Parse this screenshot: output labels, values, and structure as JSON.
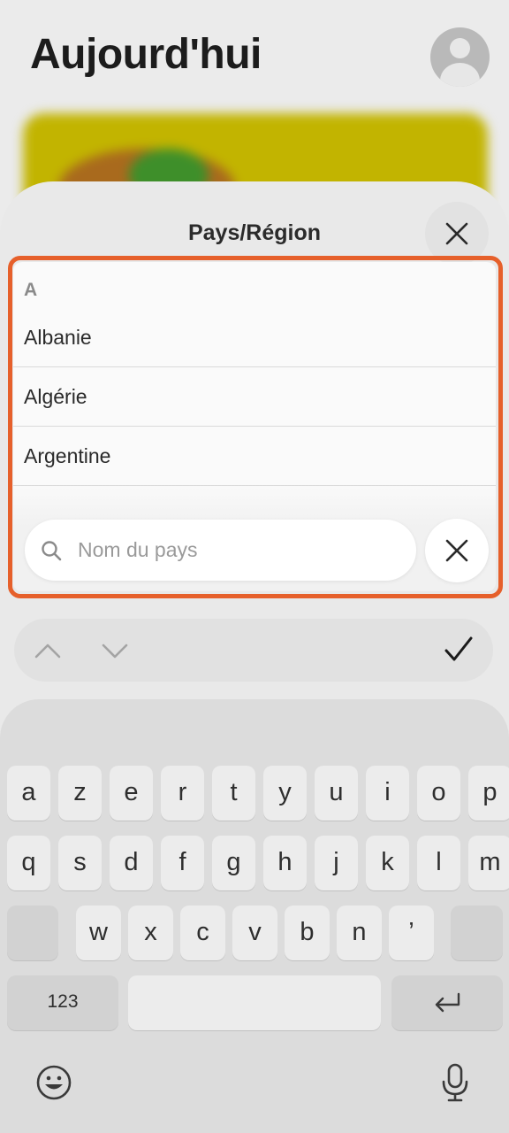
{
  "background": {
    "title": "Aujourd'hui"
  },
  "sheet": {
    "title": "Pays/Région",
    "section_letter": "A",
    "countries": [
      {
        "label": "Albanie"
      },
      {
        "label": "Algérie"
      },
      {
        "label": "Argentine"
      }
    ],
    "search": {
      "placeholder": "Nom du pays",
      "icon": "search-icon",
      "clear_icon": "close-icon"
    },
    "close_icon": "close-icon"
  },
  "keyboard": {
    "row1": [
      "a",
      "z",
      "e",
      "r",
      "t",
      "y",
      "u",
      "i",
      "o",
      "p"
    ],
    "row2": [
      "q",
      "s",
      "d",
      "f",
      "g",
      "h",
      "j",
      "k",
      "l",
      "m"
    ],
    "row3": [
      "w",
      "x",
      "c",
      "v",
      "b",
      "n",
      "’"
    ],
    "numbers_label": "123"
  },
  "colors": {
    "highlight": "#e6602b"
  }
}
